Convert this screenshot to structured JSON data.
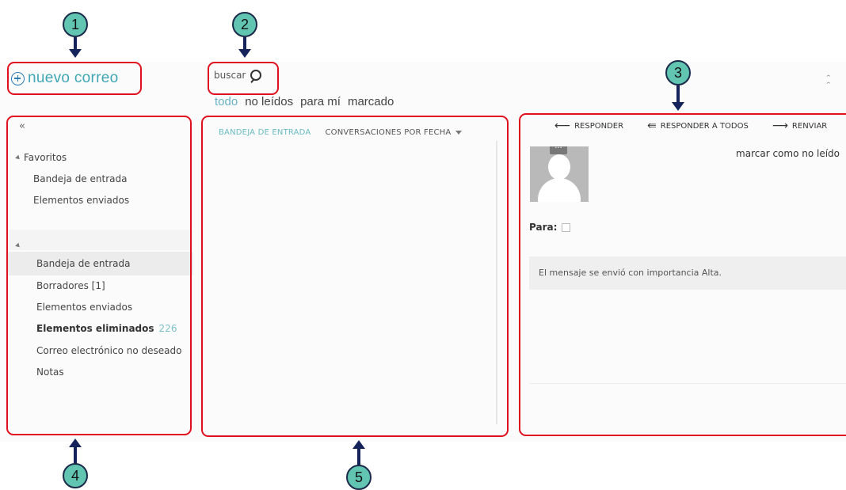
{
  "header": {
    "new_mail_label": "nuevo correo",
    "search_placeholder": "buscar",
    "collapse_header_glyph": "»"
  },
  "filters": [
    {
      "label": "todo",
      "active": true
    },
    {
      "label": "no leídos",
      "active": false
    },
    {
      "label": "para mí",
      "active": false
    },
    {
      "label": "marcado",
      "active": false
    }
  ],
  "folders": {
    "collapse_glyph": "«",
    "favorites_title": "Favoritos",
    "favorites": [
      {
        "label": "Bandeja de entrada"
      },
      {
        "label": "Elementos enviados"
      }
    ],
    "items": [
      {
        "label": "Bandeja de entrada",
        "selected": true
      },
      {
        "label": "Borradores [1]"
      },
      {
        "label": "Elementos enviados"
      },
      {
        "label": "Elementos eliminados",
        "count": "226",
        "bold": true
      },
      {
        "label": "Correo electrónico no deseado"
      },
      {
        "label": "Notas"
      }
    ]
  },
  "message_list": {
    "folder_label": "BANDEJA DE ENTRADA",
    "sort_label": "CONVERSACIONES POR FECHA"
  },
  "reading_pane": {
    "reply_label": "RESPONDER",
    "reply_all_label": "RESPONDER A TODOS",
    "forward_label": "RENVIAR",
    "mark_unread_label": "marcar como no leído",
    "avatar_more": "···",
    "to_label": "Para:",
    "importance_message": "El mensaje se envió con importancia Alta."
  },
  "callouts": [
    "1",
    "2",
    "3",
    "4",
    "5"
  ],
  "colors": {
    "annotation_red": "#e0101e",
    "callout_teal": "#62c5b1",
    "arrow_navy": "#14245a",
    "accent_teal": "#3fa6b5"
  }
}
